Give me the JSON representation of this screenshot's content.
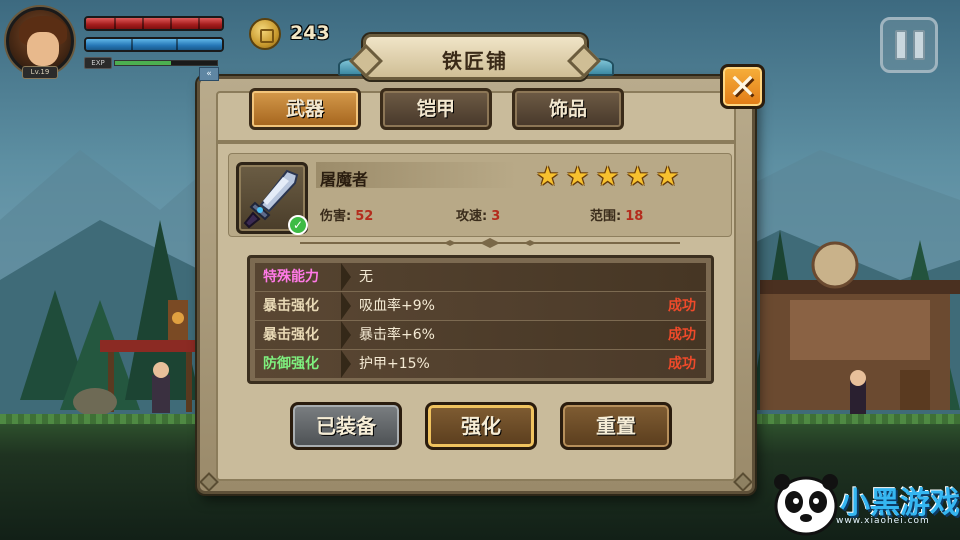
{
  "hud": {
    "level": "Lv.19",
    "hp_fraction": 1.0,
    "mp_fraction": 1.0,
    "exp_label": "EXP",
    "exp_fraction": 0.55,
    "coins": "243"
  },
  "panel": {
    "title": "铁匠铺",
    "tabs": [
      {
        "label": "武器",
        "active": true
      },
      {
        "label": "铠甲",
        "active": false
      },
      {
        "label": "饰品",
        "active": false
      }
    ],
    "item": {
      "name": "屠魔者",
      "stars": 5,
      "equipped": true,
      "stats": [
        {
          "label": "伤害:",
          "value": "52"
        },
        {
          "label": "攻速:",
          "value": "3"
        },
        {
          "label": "范围:",
          "value": "18"
        }
      ]
    },
    "abilities": [
      {
        "label": "特殊能力",
        "label_color": "#ff79e6",
        "value": "无",
        "result": ""
      },
      {
        "label": "暴击强化",
        "label_color": "#e8d9b5",
        "value": "吸血率+9%",
        "result": "成功"
      },
      {
        "label": "暴击强化",
        "label_color": "#e8d9b5",
        "value": "暴击率+6%",
        "result": "成功"
      },
      {
        "label": "防御强化",
        "label_color": "#7ef07e",
        "value": "护甲+15%",
        "result": "成功"
      }
    ],
    "buttons": {
      "equipped": "已装备",
      "enhance": "强化",
      "reset": "重置"
    }
  },
  "watermark": {
    "text": "小黑游戏",
    "url": "www.xiaohei.com"
  }
}
